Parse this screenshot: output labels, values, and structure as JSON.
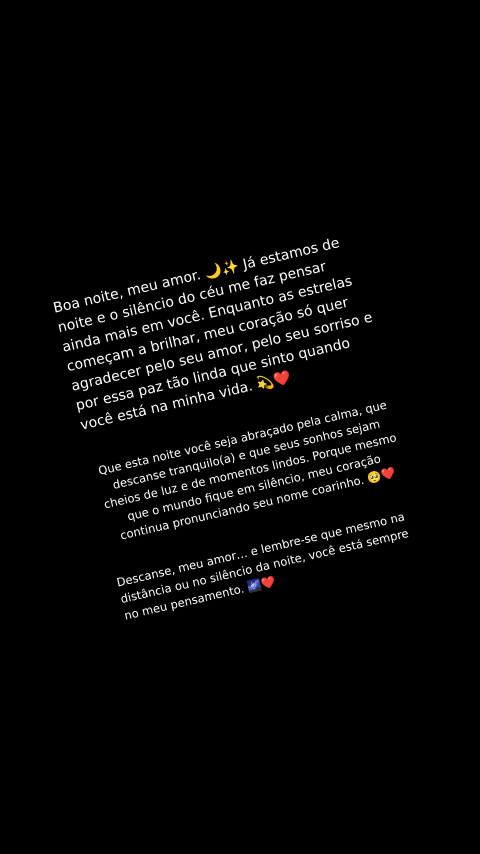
{
  "message": {
    "paragraph_1": "Boa noite, meu amor. 🌙✨ Já estamos de noite e o silêncio do céu me faz pensar ainda mais em você. Enquanto as estrelas começam a brilhar, meu coração só quer agradecer pelo seu amor, pelo seu sorriso e por essa paz tão linda que sinto quando você está na minha vida. 💫❤️",
    "paragraph_2": "Que esta noite você seja abraçado pela calma, que descanse tranquilo(a) e que seus sonhos sejam cheios de luz e de momentos lindos. Porque mesmo que o mundo fique em silêncio, meu coração continua pronunciando seu nome coarinho. 🥺❤️",
    "paragraph_3": "Descanse, meu amor… e lembre-se que mesmo na distância ou no silêncio da noite, você está sempre no meu pensamento. 🌌❤️"
  }
}
